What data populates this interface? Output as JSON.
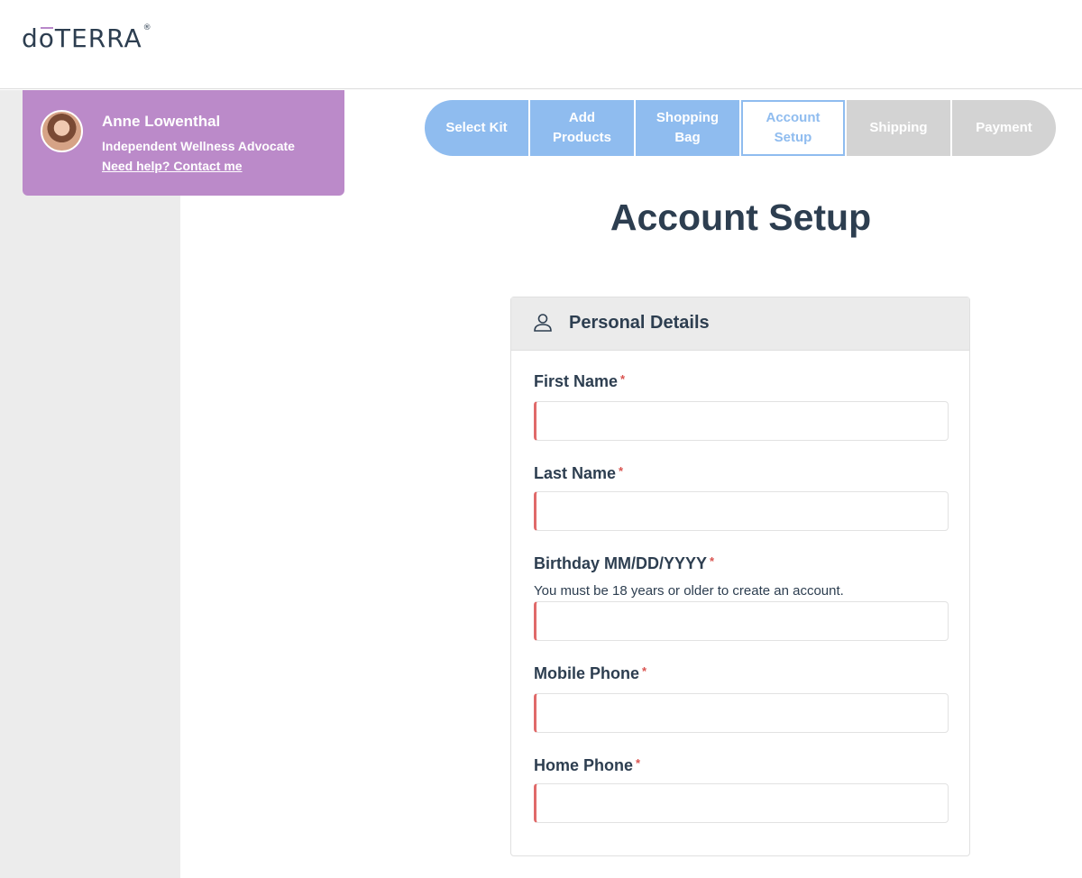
{
  "header": {
    "logo_text": "dōTERRA"
  },
  "advocate": {
    "name": "Anne Lowenthal",
    "title": "Independent Wellness Advocate",
    "help_link": "Need help? Contact me"
  },
  "steps": [
    {
      "label": "Select Kit",
      "state": "done"
    },
    {
      "label": "Add Products",
      "state": "done"
    },
    {
      "label": "Shopping Bag",
      "state": "done"
    },
    {
      "label": "Account Setup",
      "state": "active"
    },
    {
      "label": "Shipping",
      "state": "todo"
    },
    {
      "label": "Payment",
      "state": "todo"
    }
  ],
  "page_title": "Account Setup",
  "form": {
    "section_title": "Personal Details",
    "fields": [
      {
        "label": "First Name",
        "required_mark": "*",
        "value": ""
      },
      {
        "label": "Last Name",
        "required_mark": "*",
        "value": ""
      },
      {
        "label": "Birthday MM/DD/YYYY",
        "required_mark": "*",
        "hint": "You must be 18 years or older to create an account.",
        "value": ""
      },
      {
        "label": "Mobile Phone",
        "required_mark": "*",
        "value": ""
      },
      {
        "label": "Home Phone",
        "required_mark": "*",
        "value": ""
      }
    ]
  },
  "colors": {
    "advocate_bg": "#bb8ac9",
    "step_done": "#8fbcef",
    "step_todo": "#d3d3d3",
    "required": "#d9534f",
    "text_dark": "#2d3e50"
  }
}
